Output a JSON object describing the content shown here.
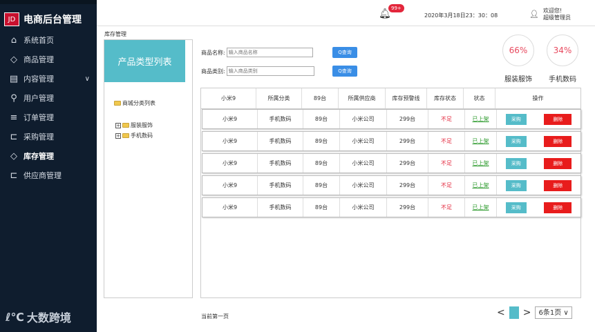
{
  "app": {
    "logo_mark": "JD",
    "title": "电商后台管理"
  },
  "sidebar": {
    "items": [
      {
        "label": "系统首页",
        "icon": "home-icon"
      },
      {
        "label": "商品管理",
        "icon": "box-icon"
      },
      {
        "label": "内容管理",
        "icon": "document-icon",
        "chevron": "∨"
      },
      {
        "label": "用户管理",
        "icon": "user-icon"
      },
      {
        "label": "订单管理",
        "icon": "list-icon"
      },
      {
        "label": "采购管理",
        "icon": "purchase-icon"
      },
      {
        "label": "库存管理",
        "icon": "box-icon"
      },
      {
        "label": "供应商管理",
        "icon": "supplier-icon"
      }
    ],
    "brand": "大数跨境",
    "brand_mark": "ℓ℃"
  },
  "header": {
    "badge": "99+",
    "datetime": "2020年3月18日23：30：08",
    "welcome_line1": "欢迎您!",
    "welcome_line2": "超级管理员"
  },
  "breadcrumb": "库存管理",
  "left_panel": {
    "title": "产品类型列表",
    "tree_root": "商城分类列表",
    "tree_nodes": [
      "服装服饰",
      "手机数码"
    ]
  },
  "search": {
    "name_label": "商品名称:",
    "name_placeholder": "输入商品名称",
    "category_label": "商品类别:",
    "category_placeholder": "输入商品类别",
    "query_label": "Q查询"
  },
  "stats": {
    "items": [
      {
        "percent": "66%",
        "label": "服装服饰"
      },
      {
        "percent": "34%",
        "label": "手机数码"
      }
    ]
  },
  "table": {
    "headers": [
      "小米9",
      "所属分类",
      "89台",
      "所属供应商",
      "库存预警线",
      "库存状态",
      "状态",
      "操作"
    ],
    "rows": [
      {
        "name": "小米9",
        "category": "手机数码",
        "qty": "89台",
        "supplier": "小米公司",
        "warning": "299台",
        "stock_status": "不足",
        "status": "已上架",
        "buy": "采购",
        "delete": "删除"
      },
      {
        "name": "小米9",
        "category": "手机数码",
        "qty": "89台",
        "supplier": "小米公司",
        "warning": "299台",
        "stock_status": "不足",
        "status": "已上架",
        "buy": "采购",
        "delete": "删除"
      },
      {
        "name": "小米9",
        "category": "手机数码",
        "qty": "89台",
        "supplier": "小米公司",
        "warning": "299台",
        "stock_status": "不足",
        "status": "已上架",
        "buy": "采购",
        "delete": "删除"
      },
      {
        "name": "小米9",
        "category": "手机数码",
        "qty": "89台",
        "supplier": "小米公司",
        "warning": "299台",
        "stock_status": "不足",
        "status": "已上架",
        "buy": "采购",
        "delete": "删除"
      },
      {
        "name": "小米9",
        "category": "手机数码",
        "qty": "89台",
        "supplier": "小米公司",
        "warning": "299台",
        "stock_status": "不足",
        "status": "已上架",
        "buy": "采购",
        "delete": "删除"
      }
    ]
  },
  "footer": {
    "current_page": "当前第一页",
    "prev": "<",
    "next": ">",
    "page_size": "6条1页 ∨"
  },
  "colors": {
    "sidebar_bg": "#0f1d2e",
    "accent": "#55bcc9",
    "danger": "#e81c1c",
    "query": "#3a8ee6"
  }
}
